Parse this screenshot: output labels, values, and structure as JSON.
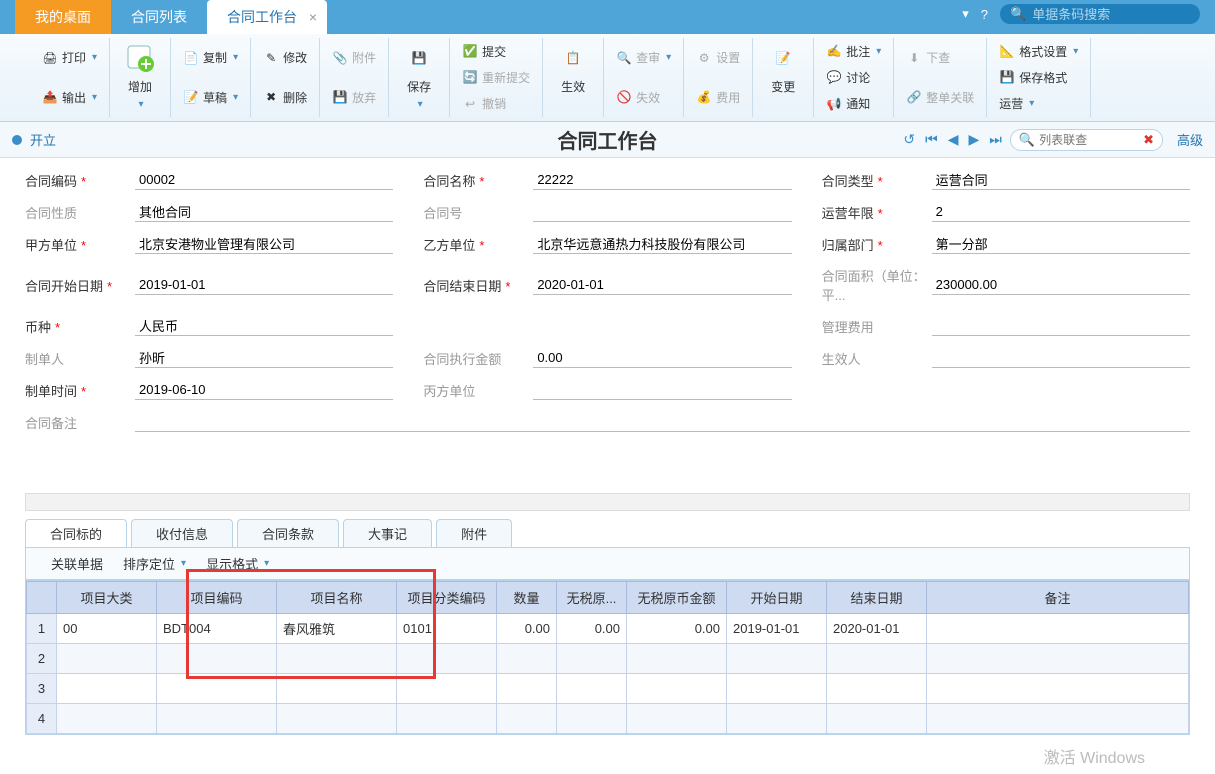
{
  "top_tabs": {
    "t1": "我的桌面",
    "t2": "合同列表",
    "t3": "合同工作台"
  },
  "search_placeholder": "单据条码搜索",
  "ribbon": {
    "print": "打印",
    "output": "输出",
    "add": "增加",
    "copy": "复制",
    "draft": "草稿",
    "modify": "修改",
    "delete": "删除",
    "attach": "附件",
    "abandon": "放弃",
    "save": "保存",
    "submit": "提交",
    "resubmit": "重新提交",
    "revoke": "撤销",
    "effect": "生效",
    "review": "查审",
    "invalid": "失效",
    "setting": "设置",
    "cost": "费用",
    "change": "变更",
    "approve": "批注",
    "discuss": "讨论",
    "notify": "通知",
    "below": "下查",
    "assoc": "整单关联",
    "format": "格式设置",
    "saveformat": "保存格式",
    "operate": "运营"
  },
  "status": {
    "open": "开立"
  },
  "page_title": "合同工作台",
  "list_search_placeholder": "列表联查",
  "adv": "高级",
  "form": {
    "code_l": "合同编码",
    "code_v": "00002",
    "name_l": "合同名称",
    "name_v": "22222",
    "type_l": "合同类型",
    "type_v": "运营合同",
    "nature_l": "合同性质",
    "nature_v": "其他合同",
    "no_l": "合同号",
    "no_v": "",
    "years_l": "运营年限",
    "years_v": "2",
    "pa_l": "甲方单位",
    "pa_v": "北京安港物业管理有限公司",
    "pb_l": "乙方单位",
    "pb_v": "北京华远意通热力科技股份有限公司",
    "dept_l": "归属部门",
    "dept_v": "第一分部",
    "start_l": "合同开始日期",
    "start_v": "2019-01-01",
    "end_l": "合同结束日期",
    "end_v": "2020-01-01",
    "area_l": "合同面积（单位：平...",
    "area_v": "230000.00",
    "curr_l": "币种",
    "curr_v": "人民币",
    "mfee_l": "管理费用",
    "mfee_v": "",
    "maker_l": "制单人",
    "maker_v": "孙昕",
    "amt_l": "合同执行金额",
    "amt_v": "0.00",
    "eff_l": "生效人",
    "eff_v": "",
    "time_l": "制单时间",
    "time_v": "2019-06-10",
    "pc_l": "丙方单位",
    "pc_v": "",
    "remark_l": "合同备注",
    "remark_v": ""
  },
  "dtabs": {
    "t1": "合同标的",
    "t2": "收付信息",
    "t3": "合同条款",
    "t4": "大事记",
    "t5": "附件"
  },
  "dtoolbar": {
    "assoc": "关联单据",
    "sort": "排序定位",
    "disp": "显示格式"
  },
  "grid_headers": {
    "cat": "项目大类",
    "code": "项目编码",
    "name": "项目名称",
    "cls": "项目分类编码",
    "qty": "数量",
    "price": "无税原...",
    "amt": "无税原币金额",
    "start": "开始日期",
    "end": "结束日期",
    "remark": "备注"
  },
  "grid_rows": [
    {
      "n": "1",
      "cat": "00",
      "code": "BDT004",
      "name": "春风雅筑",
      "cls": "0101",
      "qty": "0.00",
      "price": "0.00",
      "amt": "0.00",
      "start": "2019-01-01",
      "end": "2020-01-01",
      "remark": ""
    },
    {
      "n": "2"
    },
    {
      "n": "3"
    },
    {
      "n": "4"
    }
  ],
  "watermark": "激活 Windows"
}
